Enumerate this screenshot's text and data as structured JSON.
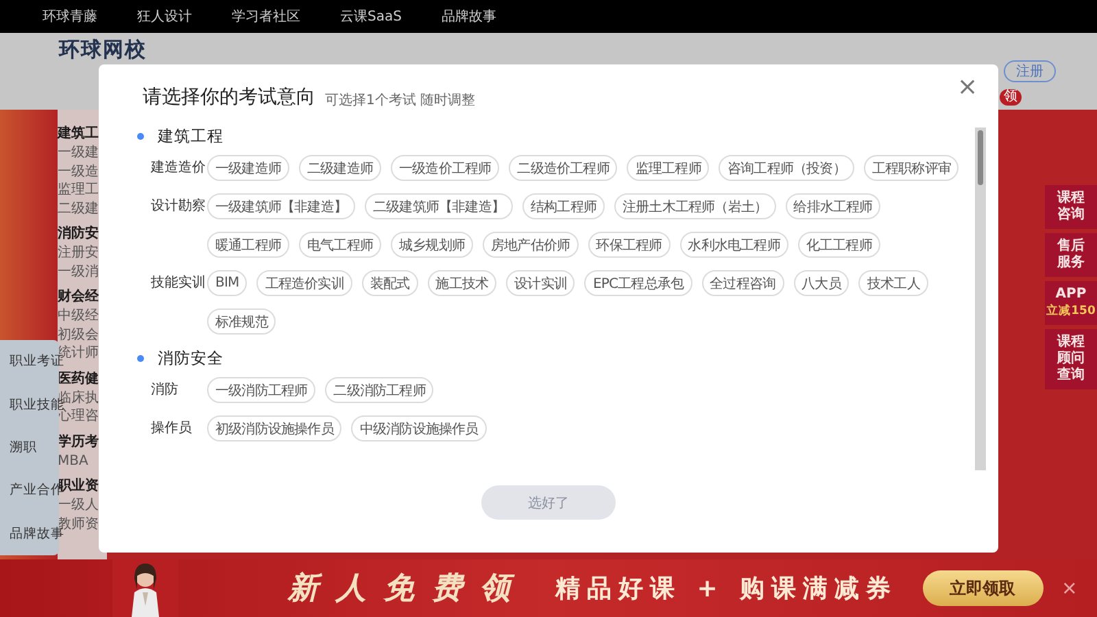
{
  "top_nav": [
    "环球青藤",
    "狂人设计",
    "学习者社区",
    "云课SaaS",
    "品牌故事"
  ],
  "header": {
    "logo": "环球网校",
    "register_button": "注册",
    "badge": "领"
  },
  "category_menu": [
    {
      "title": "建筑工",
      "items": [
        "一级建",
        "一级造",
        "监理工",
        "二级建"
      ]
    },
    {
      "title": "消防安",
      "items": [
        "注册安",
        "一级消"
      ]
    },
    {
      "title": "财会经",
      "items": [
        "中级经",
        "初级会",
        "统计师"
      ]
    },
    {
      "title": "医药健",
      "items": [
        "临床执",
        "心理咨"
      ]
    },
    {
      "title": "学历考",
      "items": [
        "MBA"
      ]
    },
    {
      "title": "职业资",
      "items": [
        "一级人",
        "教师资"
      ]
    }
  ],
  "side_nav": [
    "职业考证",
    "职业技能",
    "溯职",
    "产业合作",
    "品牌故事"
  ],
  "float_buttons": [
    {
      "lines": [
        "课程",
        "咨询"
      ]
    },
    {
      "lines": [
        "售后",
        "服务"
      ]
    },
    {
      "lines": [
        "APP"
      ],
      "note": "立减150"
    },
    {
      "lines": [
        "课程",
        "顾问",
        "查询"
      ]
    }
  ],
  "dialog": {
    "title": "请选择你的考试意向",
    "subtitle": "可选择1个考试 随时调整",
    "close": "×",
    "sections": [
      {
        "title": "建筑工程",
        "groups": [
          {
            "label": "建造造价",
            "tags": [
              "一级建造师",
              "二级建造师",
              "一级造价工程师",
              "二级造价工程师",
              "监理工程师",
              "咨询工程师（投资）",
              "工程职称评审"
            ]
          },
          {
            "label": "设计勘察",
            "tags": [
              "一级建筑师【非建造】",
              "二级建筑师【非建造】",
              "结构工程师",
              "注册土木工程师（岩土）",
              "给排水工程师",
              "暖通工程师",
              "电气工程师",
              "城乡规划师",
              "房地产估价师",
              "环保工程师",
              "水利水电工程师",
              "化工工程师"
            ]
          },
          {
            "label": "技能实训",
            "tags": [
              "BIM",
              "工程造价实训",
              "装配式",
              "施工技术",
              "设计实训",
              "EPC工程总承包",
              "全过程咨询",
              "八大员",
              "技术工人",
              "标准规范"
            ]
          }
        ]
      },
      {
        "title": "消防安全",
        "groups": [
          {
            "label": "消防",
            "tags": [
              "一级消防工程师",
              "二级消防工程师"
            ]
          },
          {
            "label": "操作员",
            "tags": [
              "初级消防设施操作员",
              "中级消防设施操作员"
            ]
          }
        ]
      }
    ],
    "confirm_button": {
      "label": "选好了",
      "disabled": true
    }
  },
  "promo_banner": {
    "headline": "新人免费领",
    "slogan": "精品好课 + 购课满减券",
    "button": "立即领取",
    "close": "×"
  }
}
